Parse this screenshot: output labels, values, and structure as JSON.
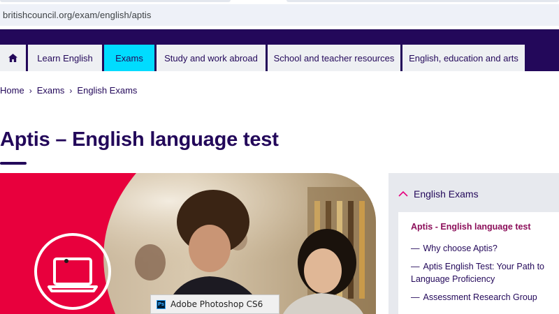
{
  "browser": {
    "url": "britishcouncil.org/exam/english/aptis"
  },
  "nav": {
    "home_icon": "home-icon",
    "items": [
      {
        "label": "Learn English"
      },
      {
        "label": "Exams",
        "active": true
      },
      {
        "label": "Study and work abroad"
      },
      {
        "label": "School and teacher resources"
      },
      {
        "label": "English, education and arts"
      }
    ]
  },
  "breadcrumb": {
    "items": [
      "Home",
      "Exams",
      "English Exams"
    ],
    "separator": "›"
  },
  "page": {
    "title": "Aptis – English language test"
  },
  "hero": {
    "icon": "laptop-icon",
    "accent_color": "#e8003d"
  },
  "tooltip": {
    "app_icon": "photoshop-icon",
    "app_icon_text": "Ps",
    "label": "Adobe Photoshop CS6"
  },
  "sidebar": {
    "heading": "English Exams",
    "current": "Aptis - English language test",
    "dash": "—",
    "links": [
      "Why choose Aptis?",
      "Aptis English Test: Your Path to Language Proficiency",
      "Assessment Research Group"
    ]
  },
  "colors": {
    "brand_purple": "#23085a",
    "active_cyan": "#00dcff",
    "magenta": "#8c0f5a",
    "red": "#e8003d"
  }
}
